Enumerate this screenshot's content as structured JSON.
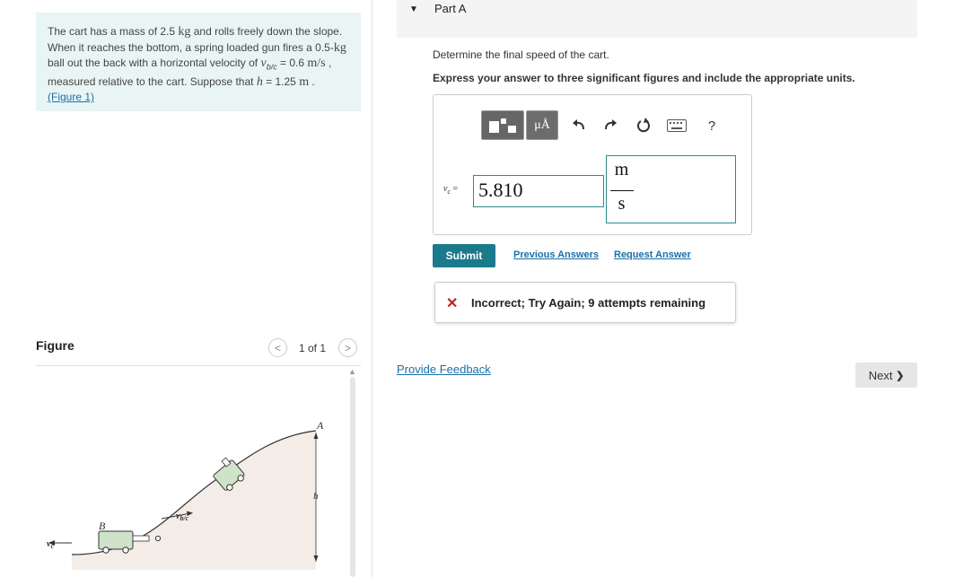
{
  "problem": {
    "t1": "The cart has a mass of 2.5 ",
    "u1": "kg",
    "t2": " and rolls freely down the slope. When it reaches the bottom, a spring loaded gun fires a 0.5-",
    "u2": "kg",
    "t3": " ball out the back with a horizontal velocity of ",
    "v_sym": "v",
    "v_sub": "b/c",
    "t4": " = 0.6 ",
    "u3": "m/s",
    "t5": " , measured relative to the cart. Suppose that ",
    "h_sym": "h",
    "t6": " = 1.25 ",
    "u4": "m",
    "t7": " . ",
    "link": "(Figure 1)"
  },
  "figure": {
    "label": "Figure",
    "counter": "1 of 1",
    "prev_icon": "chevron-left-icon",
    "next_icon": "chevron-right-icon",
    "labels": {
      "a": "A",
      "b": "B",
      "h": "h",
      "vc": "v",
      "vc_sub": "c",
      "vbc": "v",
      "vbc_sub": "b/c"
    }
  },
  "part": {
    "title": "Part A",
    "question": "Determine the final speed of the cart.",
    "instruction": "Express your answer to three significant figures and include the appropriate units."
  },
  "toolbar": {
    "units_label": "μÅ",
    "help_label": "?",
    "icons": [
      "templates-icon",
      "units-icon",
      "undo-icon",
      "redo-icon",
      "reset-icon",
      "keyboard-icon",
      "help-icon"
    ]
  },
  "answer": {
    "var_symbol": "v",
    "var_sub": "c",
    "equals": " =",
    "value": "5.810",
    "unit_num": "m",
    "unit_den": "s"
  },
  "actions": {
    "submit": "Submit",
    "previous_answers": "Previous Answers",
    "request_answer": "Request Answer"
  },
  "feedback": {
    "icon": "✕",
    "text": "Incorrect; Try Again; 9 attempts remaining"
  },
  "footer": {
    "provide_feedback": "Provide Feedback",
    "next": "Next",
    "next_icon": "❯"
  },
  "colors": {
    "accent": "#1a7a8c",
    "link": "#1a6fa8",
    "error": "#c81e1e",
    "input_border": "#2e8a8a",
    "problem_bg": "#e9f5f5",
    "cart_fill": "#cfe3c8"
  }
}
